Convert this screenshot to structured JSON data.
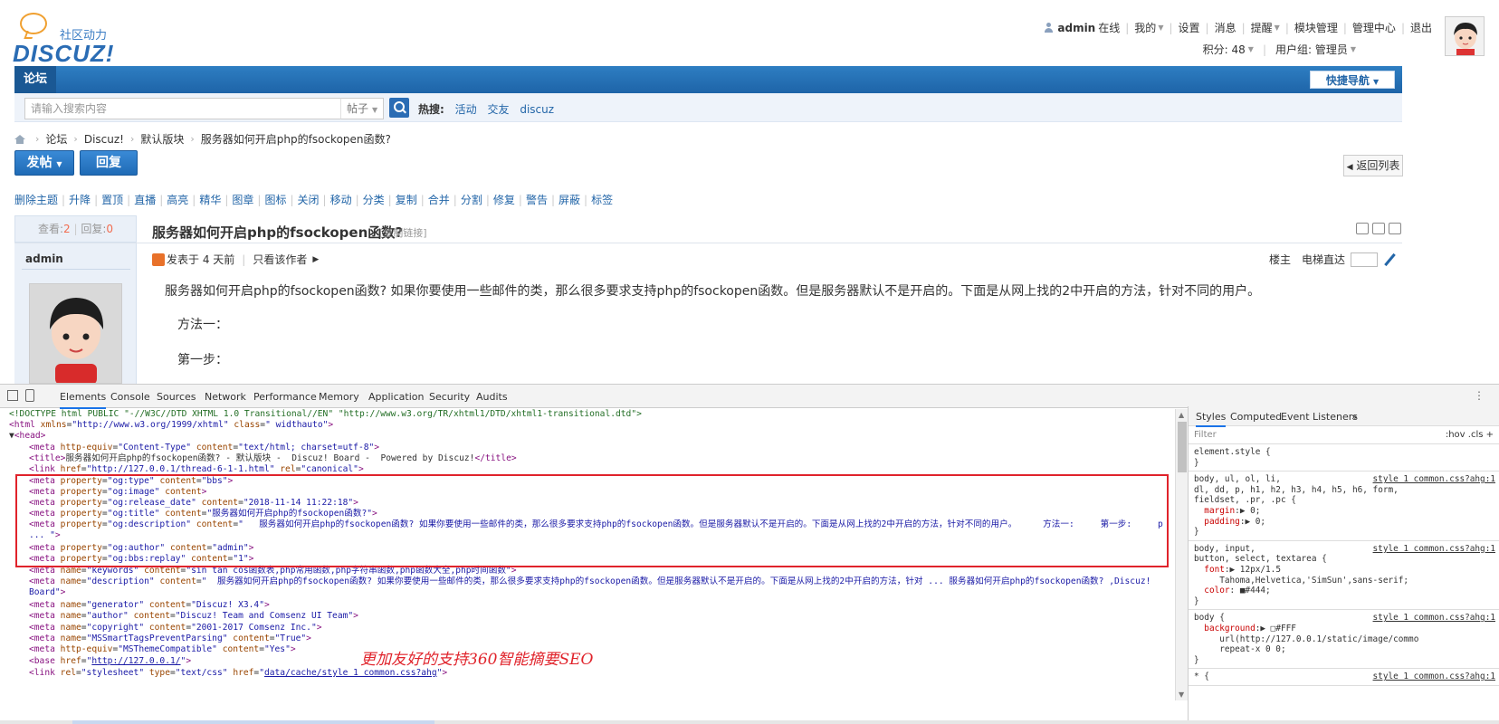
{
  "header": {
    "logo_tag": "社区动力",
    "logo_text": "DISCUZ!",
    "user": "admin",
    "status": "在线",
    "links": [
      "我的",
      "设置",
      "消息",
      "提醒",
      "模块管理",
      "管理中心",
      "退出"
    ],
    "points": "积分: 48",
    "group": "用户组: 管理员"
  },
  "nav": {
    "tab": "论坛",
    "quick": "快捷导航"
  },
  "search": {
    "placeholder": "请输入搜索内容",
    "type": "帖子",
    "hot_label": "热搜:",
    "hot": [
      "活动",
      "交友",
      "discuz"
    ]
  },
  "breadcrumb": [
    "论坛",
    "Discuz!",
    "默认版块",
    "服务器如何开启php的fsockopen函数?"
  ],
  "buttons": {
    "post": "发帖",
    "reply": "回复",
    "back": "返回列表"
  },
  "mod_actions": [
    "删除主题",
    "升降",
    "置顶",
    "直播",
    "高亮",
    "精华",
    "图章",
    "图标",
    "关闭",
    "移动",
    "分类",
    "复制",
    "合并",
    "分割",
    "修复",
    "警告",
    "屏蔽",
    "标签"
  ],
  "thread": {
    "views_label": "查看:",
    "views": "2",
    "replies_label": "回复:",
    "replies": "0",
    "title": "服务器如何开启php的fsockopen函数?",
    "copy_link": "[复制链接]",
    "author": "admin",
    "posted": "发表于 4 天前",
    "only_author": "只看该作者",
    "floor": "楼主",
    "jump": "电梯直达",
    "body": "服务器如何开启php的fsockopen函数? 如果你要使用一些邮件的类，那么很多要求支持php的fsockopen函数。但是服务器默认不是开启的。下面是从网上找的2中开启的方法，针对不同的用户。",
    "p1": "方法一：",
    "p2": "第一步："
  },
  "devtools": {
    "tabs": [
      "Elements",
      "Console",
      "Sources",
      "Network",
      "Performance",
      "Memory",
      "Application",
      "Security",
      "Audits"
    ],
    "annotation": "更加友好的支持360智能摘要SEO",
    "styles_tabs": [
      "Styles",
      "Computed",
      "Event Listeners"
    ],
    "filter": "Filter",
    "filter_right": ":hov  .cls  +",
    "rules": [
      {
        "selector": "element.style {",
        "lines": [
          "}"
        ],
        "src": ""
      },
      {
        "selector": "body, ul, ol, li,",
        "lines": [
          "dl, dd, p, h1, h2, h3, h4, h5, h6, form,",
          "fieldset, .pr, .pc {",
          "  margin:▶ 0;",
          "  padding:▶ 0;",
          "}"
        ],
        "src": "style 1 common.css?ahg:1"
      },
      {
        "selector": "body, input,",
        "lines": [
          "button, select, textarea {",
          "  font:▶ 12px/1.5",
          "     Tahoma,Helvetica,'SimSun',sans-serif;",
          "  color: ■#444;",
          "}"
        ],
        "src": "style 1 common.css?ahg:1"
      },
      {
        "selector": "body {",
        "lines": [
          "  background:▶ □#FFF",
          "     url(http://127.0.0.1/static/image/commo",
          "     repeat-x 0 0;",
          "}"
        ],
        "src": "style 1 common.css?ahg:1"
      },
      {
        "selector": "* {",
        "lines": [],
        "src": "style 1 common.css?ahg:1"
      }
    ]
  },
  "colors": {
    "brand": "#2a6cb4",
    "nav": "#1e64a8",
    "highlight": "#e0232b"
  }
}
